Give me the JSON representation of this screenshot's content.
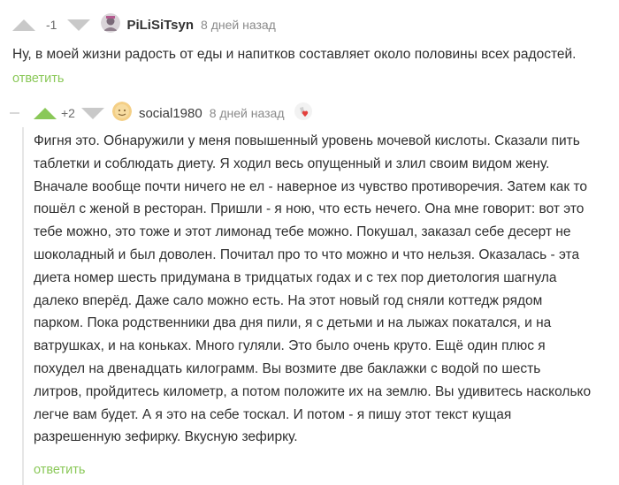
{
  "comment1": {
    "rating": "-1",
    "username": "PiLiSiTsyn",
    "time": "8 дней назад",
    "text": "Ну, в моей жизни радость от еды и напитков составляет около половины всех радостей.",
    "reply_label": "ответить"
  },
  "comment2": {
    "rating": "+2",
    "username": "social1980",
    "time": "8 дней назад",
    "lines": [
      "Фигня это. Обнаружили у меня повышенный уровень мочевой кислоты. Сказали пить",
      "таблетки и соблюдать диету. Я ходил весь опущенный и злил своим видом жену.",
      "Вначале вообще почти ничего не ел - наверное из чувство противоречия. Затем как то",
      "пошёл с женой в ресторан. Пришли - я ною, что есть нечего. Она мне говорит: вот это",
      "тебе можно, это тоже и этот лимонад тебе можно. Покушал, заказал себе десерт не",
      "шоколадный и был доволен. Почитал про то что можно и что нельзя. Оказалась - эта",
      "диета номер шесть придумана в тридцатых годах и с тех пор диетология шагнула",
      "далеко вперёд. Даже сало можно есть. На этот новый год сняли коттедж рядом",
      "парком. Пока родственники два дня пили, я с детьми и на лыжах покатался, и на",
      "ватрушках, и на коньках. Много гуляли. Это было очень круто. Ещё один плюс я",
      "похудел на двенадцать килограмм. Вы возмите две баклажки с водой по шесть",
      "литров, пройдитесь километр, а потом положите их на землю. Вы удивитесь насколько",
      "легче вам будет. А я это на себе тоскал. И потом - я пишу этот текст кущая",
      "разрешенную зефирку. Вкусную зефирку."
    ],
    "reply_label": "ответить"
  }
}
